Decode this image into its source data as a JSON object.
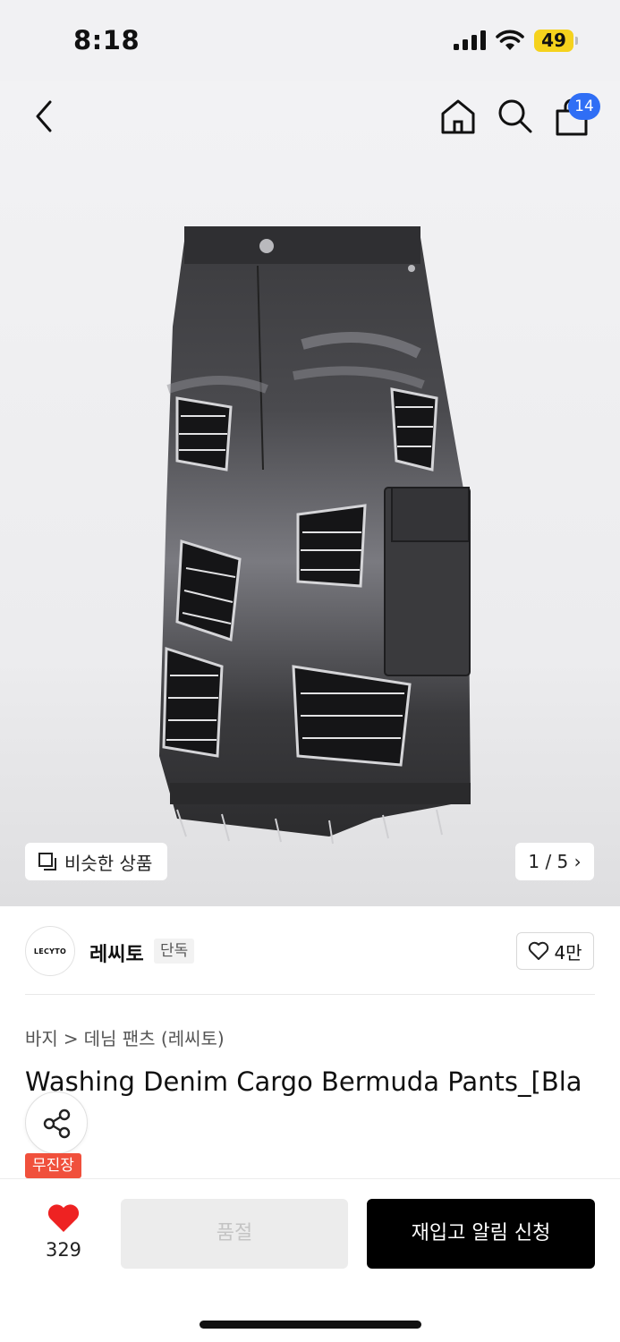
{
  "status_bar": {
    "time": "8:18",
    "battery": "49"
  },
  "nav": {
    "cart_count": "14",
    "icons": [
      "back-icon",
      "home-icon",
      "search-icon",
      "cart-icon"
    ]
  },
  "gallery": {
    "similar_label": "비슷한 상품",
    "pager": "1 / 5 ›"
  },
  "brand": {
    "logo_text": "LECYTO",
    "name": "레씨토",
    "tag": "단독",
    "likes": "4만"
  },
  "breadcrumb": {
    "category": "바지",
    "separator": ">",
    "subcategory": "데님 팬츠 (레씨토)"
  },
  "product": {
    "title": "Washing Denim Cargo Bermuda Pants_[Bla",
    "store_tag": "무진장"
  },
  "bottom_bar": {
    "like_count": "329",
    "soldout_label": "품절",
    "restock_label": "재입고 알림 신청"
  },
  "colors": {
    "accent_blue": "#2f6ef5",
    "heart_red": "#ee2222",
    "tag_orange": "#f0503c",
    "battery_yellow": "#f5d21d"
  }
}
